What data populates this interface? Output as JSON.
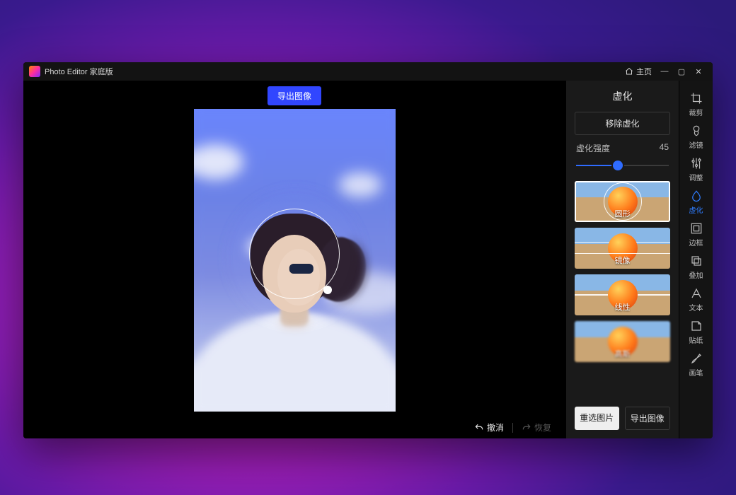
{
  "app": {
    "title": "Photo Editor 家庭版"
  },
  "titlebar": {
    "home_label": "主页",
    "minimize": "—",
    "maximize": "▢",
    "close": "✕"
  },
  "canvas": {
    "export_label": "导出图像",
    "undo_label": "撤消",
    "redo_label": "恢复"
  },
  "panel": {
    "title": "虚化",
    "remove_label": "移除虚化",
    "slider_label": "虚化强度",
    "slider_value": 45,
    "slider_min": 0,
    "slider_max": 100,
    "presets": [
      {
        "id": "round",
        "label": "圆形",
        "selected": true
      },
      {
        "id": "mirror",
        "label": "镜像",
        "selected": false
      },
      {
        "id": "linear",
        "label": "线性",
        "selected": false
      },
      {
        "id": "gauss",
        "label": "高斯",
        "selected": false
      }
    ],
    "reselect_label": "重选图片",
    "export_label": "导出图像"
  },
  "rail": [
    {
      "id": "crop",
      "label": "裁剪",
      "active": false
    },
    {
      "id": "filter",
      "label": "滤镜",
      "active": false
    },
    {
      "id": "adjust",
      "label": "调整",
      "active": false
    },
    {
      "id": "blur",
      "label": "虚化",
      "active": true
    },
    {
      "id": "frame",
      "label": "边框",
      "active": false
    },
    {
      "id": "overlay",
      "label": "叠加",
      "active": false
    },
    {
      "id": "text",
      "label": "文本",
      "active": false
    },
    {
      "id": "sticker",
      "label": "贴纸",
      "active": false
    },
    {
      "id": "brush",
      "label": "画笔",
      "active": false
    }
  ]
}
